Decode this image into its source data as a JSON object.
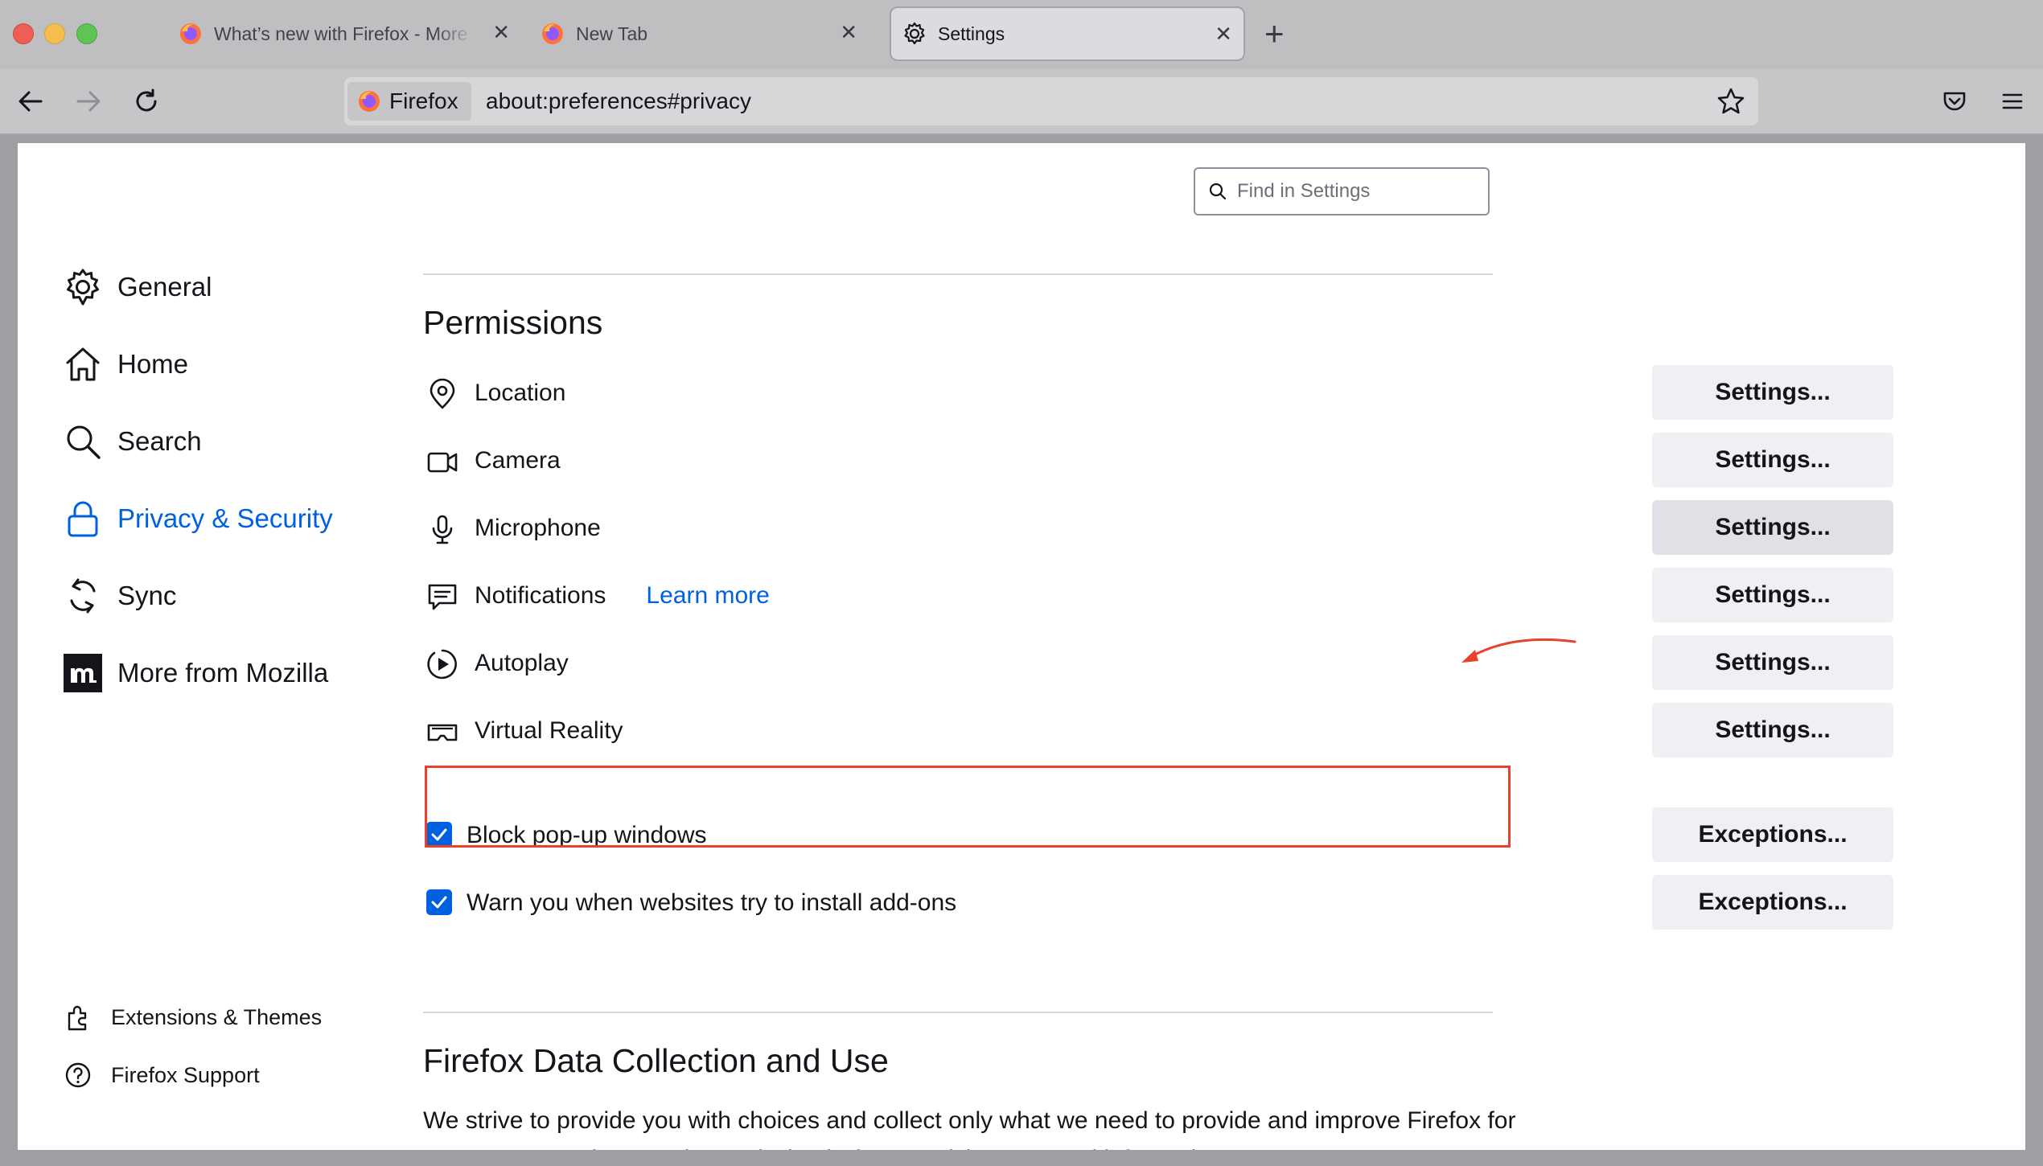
{
  "window": {
    "tabs": [
      {
        "title": "What’s new with Firefox - More protection, more privacy",
        "active": false,
        "icon": "firefox-logo-icon"
      },
      {
        "title": "New Tab",
        "active": false,
        "icon": "firefox-logo-icon"
      },
      {
        "title": "Settings",
        "active": true,
        "icon": "gear-icon"
      }
    ],
    "tab_close_glyph": "✕",
    "new_tab_glyph": "+"
  },
  "navbar": {
    "identity_label": "Firefox",
    "url": "about:preferences#privacy"
  },
  "search": {
    "placeholder": "Find in Settings"
  },
  "sidebar": {
    "items": [
      {
        "label": "General",
        "icon": "gear-icon",
        "selected": false
      },
      {
        "label": "Home",
        "icon": "home-icon",
        "selected": false
      },
      {
        "label": "Search",
        "icon": "search-icon",
        "selected": false
      },
      {
        "label": "Privacy & Security",
        "icon": "lock-icon",
        "selected": true
      },
      {
        "label": "Sync",
        "icon": "sync-icon",
        "selected": false
      },
      {
        "label": "More from Mozilla",
        "icon": "mozilla-m-icon",
        "selected": false
      }
    ],
    "footer": [
      {
        "label": "Extensions & Themes",
        "icon": "puzzle-piece-icon"
      },
      {
        "label": "Firefox Support",
        "icon": "help-icon"
      }
    ]
  },
  "permissions": {
    "title": "Permissions",
    "rows": [
      {
        "label": "Location",
        "icon": "location-pin-icon",
        "button": "Settings..."
      },
      {
        "label": "Camera",
        "icon": "camera-icon",
        "button": "Settings..."
      },
      {
        "label": "Microphone",
        "icon": "microphone-icon",
        "button": "Settings..."
      },
      {
        "label": "Notifications",
        "icon": "notification-icon",
        "button": "Settings...",
        "link": "Learn more"
      },
      {
        "label": "Autoplay",
        "icon": "autoplay-icon",
        "button": "Settings..."
      },
      {
        "label": "Virtual Reality",
        "icon": "vr-headset-icon",
        "button": "Settings..."
      }
    ],
    "checkboxes": [
      {
        "label": "Block pop-up windows",
        "checked": true,
        "button": "Exceptions..."
      },
      {
        "label": "Warn you when websites try to install add-ons",
        "checked": true,
        "button": "Exceptions..."
      }
    ]
  },
  "data_collection": {
    "title": "Firefox Data Collection and Use",
    "text": "We strive to provide you with choices and collect only what we need to provide and improve Firefox for everyone. We always ask permission before receiving personal information."
  },
  "colors": {
    "accent": "#0061e0",
    "annotation": "#e8412c",
    "button_bg": "#f0f0f4"
  }
}
